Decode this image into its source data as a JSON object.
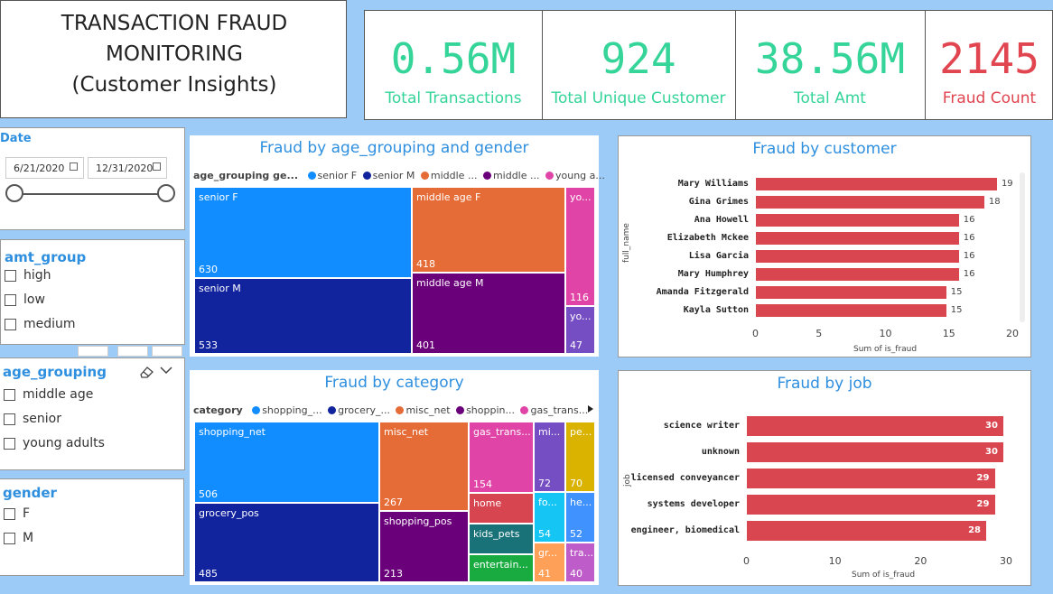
{
  "header": {
    "title_line1": "TRANSACTION FRAUD",
    "title_line2": "MONITORING",
    "title_line3": "(Customer Insights)"
  },
  "kpis": [
    {
      "value": "0.56M",
      "label": "Total Transactions"
    },
    {
      "value": "924",
      "label": "Total Unique Customer"
    },
    {
      "value": "38.56M",
      "label": "Total Amt"
    },
    {
      "value": "2145",
      "label": "Fraud Count"
    }
  ],
  "date_slicer": {
    "title": "Date",
    "start": "6/21/2020",
    "end": "12/31/2020"
  },
  "amt_group": {
    "title": "amt_group",
    "options": [
      "high",
      "low",
      "medium"
    ]
  },
  "age_grouping": {
    "title": "age_grouping",
    "options": [
      "middle age",
      "senior",
      "young adults"
    ]
  },
  "gender": {
    "title": "gender",
    "options": [
      "F",
      "M"
    ]
  },
  "treemap_age": {
    "title": "Fraud by age_grouping and gender",
    "legend_title": "age_grouping ge...",
    "legend": [
      {
        "label": "senior F",
        "color": "#118dff"
      },
      {
        "label": "senior M",
        "color": "#12239e"
      },
      {
        "label": "middle ...",
        "color": "#e66c37"
      },
      {
        "label": "middle ...",
        "color": "#6b007b"
      },
      {
        "label": "young a...",
        "color": "#e044a7"
      }
    ],
    "tiles": [
      {
        "label": "senior F",
        "value": "630"
      },
      {
        "label": "senior M",
        "value": "533"
      },
      {
        "label": "middle age F",
        "value": "418"
      },
      {
        "label": "middle age M",
        "value": "401"
      },
      {
        "label": "yo...",
        "value": "116"
      },
      {
        "label": "yo...",
        "value": "47"
      }
    ]
  },
  "treemap_cat": {
    "title": "Fraud by category",
    "legend_title": "category",
    "legend": [
      {
        "label": "shopping_...",
        "color": "#118dff"
      },
      {
        "label": "grocery_...",
        "color": "#12239e"
      },
      {
        "label": "misc_net",
        "color": "#e66c37"
      },
      {
        "label": "shoppin...",
        "color": "#6b007b"
      },
      {
        "label": "gas_trans...",
        "color": "#e044a7"
      }
    ],
    "tiles": [
      {
        "label": "shopping_net",
        "value": "506"
      },
      {
        "label": "grocery_pos",
        "value": "485"
      },
      {
        "label": "misc_net",
        "value": "267"
      },
      {
        "label": "shopping_pos",
        "value": "213"
      },
      {
        "label": "gas_trans...",
        "value": "154"
      },
      {
        "label": "home",
        "value": ""
      },
      {
        "label": "kids_pets",
        "value": ""
      },
      {
        "label": "entertain...",
        "value": ""
      },
      {
        "label": "mi...",
        "value": "72"
      },
      {
        "label": "pe...",
        "value": "70"
      },
      {
        "label": "fo...",
        "value": "54"
      },
      {
        "label": "he...",
        "value": "52"
      },
      {
        "label": "gr...",
        "value": "41"
      },
      {
        "label": "tra...",
        "value": "40"
      }
    ]
  },
  "chart_data": [
    {
      "type": "bar",
      "title": "Fraud by customer",
      "ylabel": "full_name",
      "xlabel": "Sum of is_fraud",
      "categories": [
        "Mary Williams",
        "Gina Grimes",
        "Ana Howell",
        "Elizabeth Mckee",
        "Lisa Garcia",
        "Mary Humphrey",
        "Amanda Fitzgerald",
        "Kayla Sutton"
      ],
      "values": [
        19,
        18,
        16,
        16,
        16,
        16,
        15,
        15
      ],
      "xlim": [
        0,
        20
      ],
      "ticks": [
        "0",
        "5",
        "10",
        "15",
        "20"
      ]
    },
    {
      "type": "bar",
      "title": "Fraud by job",
      "ylabel": "job",
      "xlabel": "Sum of is_fraud",
      "categories": [
        "science writer",
        "unknown",
        "licensed conveyancer",
        "systems developer",
        "engineer, biomedical"
      ],
      "values": [
        30,
        30,
        29,
        29,
        28
      ],
      "xlim": [
        0,
        30
      ],
      "ticks": [
        "0",
        "10",
        "20",
        "30"
      ]
    }
  ],
  "colors": {
    "bar": "#d9464f",
    "kpi_green": "#35d499",
    "kpi_red": "#e04550",
    "title_blue": "#2f8fdf"
  }
}
